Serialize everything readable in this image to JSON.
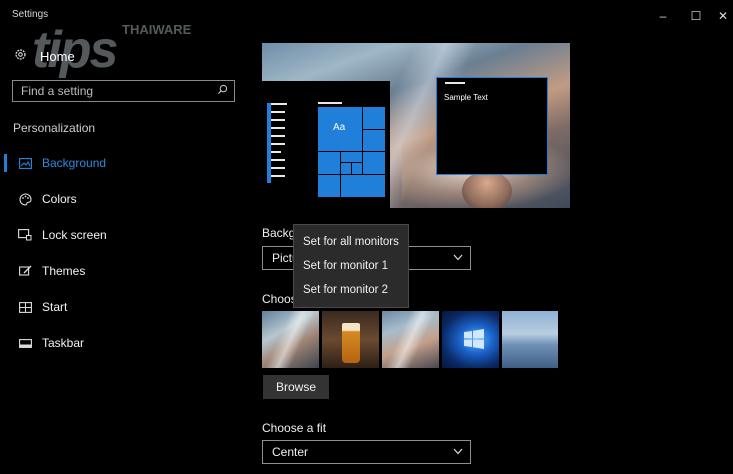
{
  "window": {
    "title": "Settings",
    "minimize_glyph": "–",
    "maximize_glyph": "☐",
    "close_glyph": "✕"
  },
  "watermark": {
    "main": "tips",
    "sub": "THAIWARE"
  },
  "sidebar": {
    "home_label": "Home",
    "search_placeholder": "Find a setting",
    "section_label": "Personalization",
    "items": [
      {
        "label": "Background",
        "icon": "image-icon",
        "active": true
      },
      {
        "label": "Colors",
        "icon": "palette-icon",
        "active": false
      },
      {
        "label": "Lock screen",
        "icon": "lock-screen-icon",
        "active": false
      },
      {
        "label": "Themes",
        "icon": "brush-icon",
        "active": false
      },
      {
        "label": "Start",
        "icon": "start-grid-icon",
        "active": false
      },
      {
        "label": "Taskbar",
        "icon": "taskbar-icon",
        "active": false
      }
    ]
  },
  "preview": {
    "tile_label": "Aa",
    "sample_text": "Sample Text"
  },
  "background": {
    "label": "Backgr",
    "value": "Pictu"
  },
  "choose_picture_label": "Choos",
  "thumbnails": [
    "space-clouds",
    "beer-glass",
    "space-clouds-alt",
    "windows-10-hero",
    "sunset-beach"
  ],
  "browse_label": "Browse",
  "fit": {
    "label": "Choose a fit",
    "value": "Center"
  },
  "context_menu": {
    "items": [
      "Set for all monitors",
      "Set for monitor 1",
      "Set for monitor 2"
    ]
  },
  "colors": {
    "accent": "#1f7fd9",
    "background": "#000000",
    "menu_bg": "#2b2b2b"
  }
}
